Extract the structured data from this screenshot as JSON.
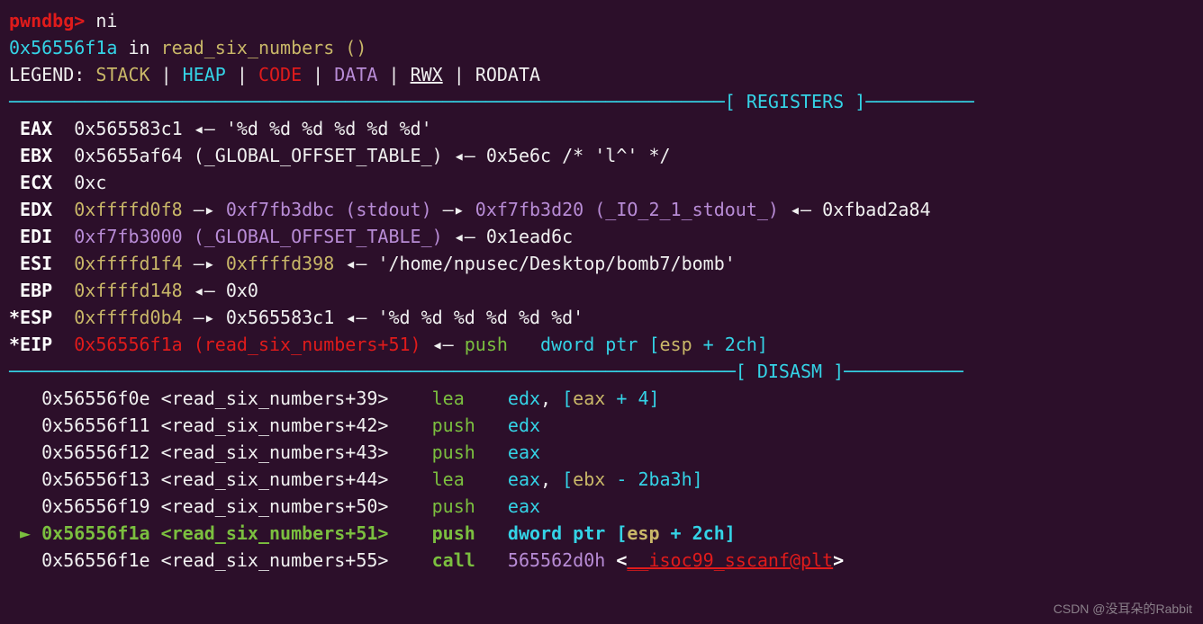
{
  "prompt": {
    "label": "pwndbg>",
    "cmd": "ni"
  },
  "context": {
    "addr": "0x56556f1a",
    "in": " in ",
    "func": "read_six_numbers ()"
  },
  "legend": {
    "label": "LEGEND: ",
    "stack": "STACK",
    "heap": "HEAP",
    "code": "CODE",
    "data": "DATA",
    "rwx": "RWX",
    "rodata": "RODATA",
    "sep": " | "
  },
  "sections": {
    "registers": "REGISTERS",
    "disasm": "DISASM"
  },
  "registers": {
    "eax": {
      "name": " EAX  ",
      "val": "0x565583c1",
      "arrow": " ◂— ",
      "str": "'%d %d %d %d %d %d'"
    },
    "ebx": {
      "name": " EBX  ",
      "val": "0x5655af64",
      "sym": " (_GLOBAL_OFFSET_TABLE_) ",
      "arrow": "◂— ",
      "p1": "0x5e6c /* 'l^' */"
    },
    "ecx": {
      "name": " ECX  ",
      "val": "0xc"
    },
    "edx": {
      "name": " EDX  ",
      "val": "0xffffd0f8",
      "a1": " —▸ ",
      "p1": "0xf7fb3dbc (stdout)",
      "a2": " —▸ ",
      "p2": "0xf7fb3d20 (_IO_2_1_stdout_)",
      "a3": " ◂— ",
      "p3": "0xfbad2a84"
    },
    "edi": {
      "name": " EDI  ",
      "val": "0xf7fb3000 (_GLOBAL_OFFSET_TABLE_)",
      "a1": " ◂— ",
      "p1": "0x1ead6c"
    },
    "esi": {
      "name": " ESI  ",
      "val": "0xffffd1f4",
      "a1": " —▸ ",
      "p1": "0xffffd398",
      "a2": " ◂— ",
      "str": "'/home/npusec/Desktop/bomb7/bomb'"
    },
    "ebp": {
      "name": " EBP  ",
      "val": "0xffffd148",
      "a1": " ◂— ",
      "p1": "0x0"
    },
    "esp": {
      "name": "*ESP  ",
      "val": "0xffffd0b4",
      "a1": " —▸ ",
      "p1": "0x565583c1",
      "a2": " ◂— ",
      "str": "'%d %d %d %d %d %d'"
    },
    "eip": {
      "name": "*EIP  ",
      "val": "0x56556f1a (read_six_numbers+51)",
      "a1": " ◂— ",
      "op": "push   ",
      "arg1": "dword ptr ",
      "b1": "[",
      "reg": "esp ",
      "plus": "+ ",
      "off": "2ch",
      "b2": "]"
    }
  },
  "disasm": [
    {
      "addr": "   0x56556f0e ",
      "sym": "<read_six_numbers+39>    ",
      "op": "lea    ",
      "a1": "edx",
      "c1": ", ",
      "b1": "[",
      "r1": "eax ",
      "p1": "+ ",
      "off": "4",
      "b2": "]"
    },
    {
      "addr": "   0x56556f11 ",
      "sym": "<read_six_numbers+42>    ",
      "op": "push   ",
      "a1": "edx"
    },
    {
      "addr": "   0x56556f12 ",
      "sym": "<read_six_numbers+43>    ",
      "op": "push   ",
      "a1": "eax"
    },
    {
      "addr": "   0x56556f13 ",
      "sym": "<read_six_numbers+44>    ",
      "op": "lea    ",
      "a1": "eax",
      "c1": ", ",
      "b1": "[",
      "r1": "ebx ",
      "p1": "- ",
      "off": "2ba3h",
      "b2": "]"
    },
    {
      "addr": "   0x56556f19 ",
      "sym": "<read_six_numbers+50>    ",
      "op": "push   ",
      "a1": "eax"
    },
    {
      "cur": true,
      "marker": " ► ",
      "addr": "0x56556f1a ",
      "sym": "<read_six_numbers+51>    ",
      "op": "push   ",
      "a1": "dword ptr ",
      "b1": "[",
      "r1": "esp ",
      "p1": "+ ",
      "off": "2ch",
      "b2": "]"
    },
    {
      "addr": "   0x56556f1e ",
      "sym": "<read_six_numbers+55>    ",
      "op": "call   ",
      "a1": "565562d0h ",
      "lt": "<",
      "fn": "__isoc99_sscanf@plt",
      "gt": ">"
    }
  ],
  "watermark": "CSDN @没耳朵的Rabbit"
}
